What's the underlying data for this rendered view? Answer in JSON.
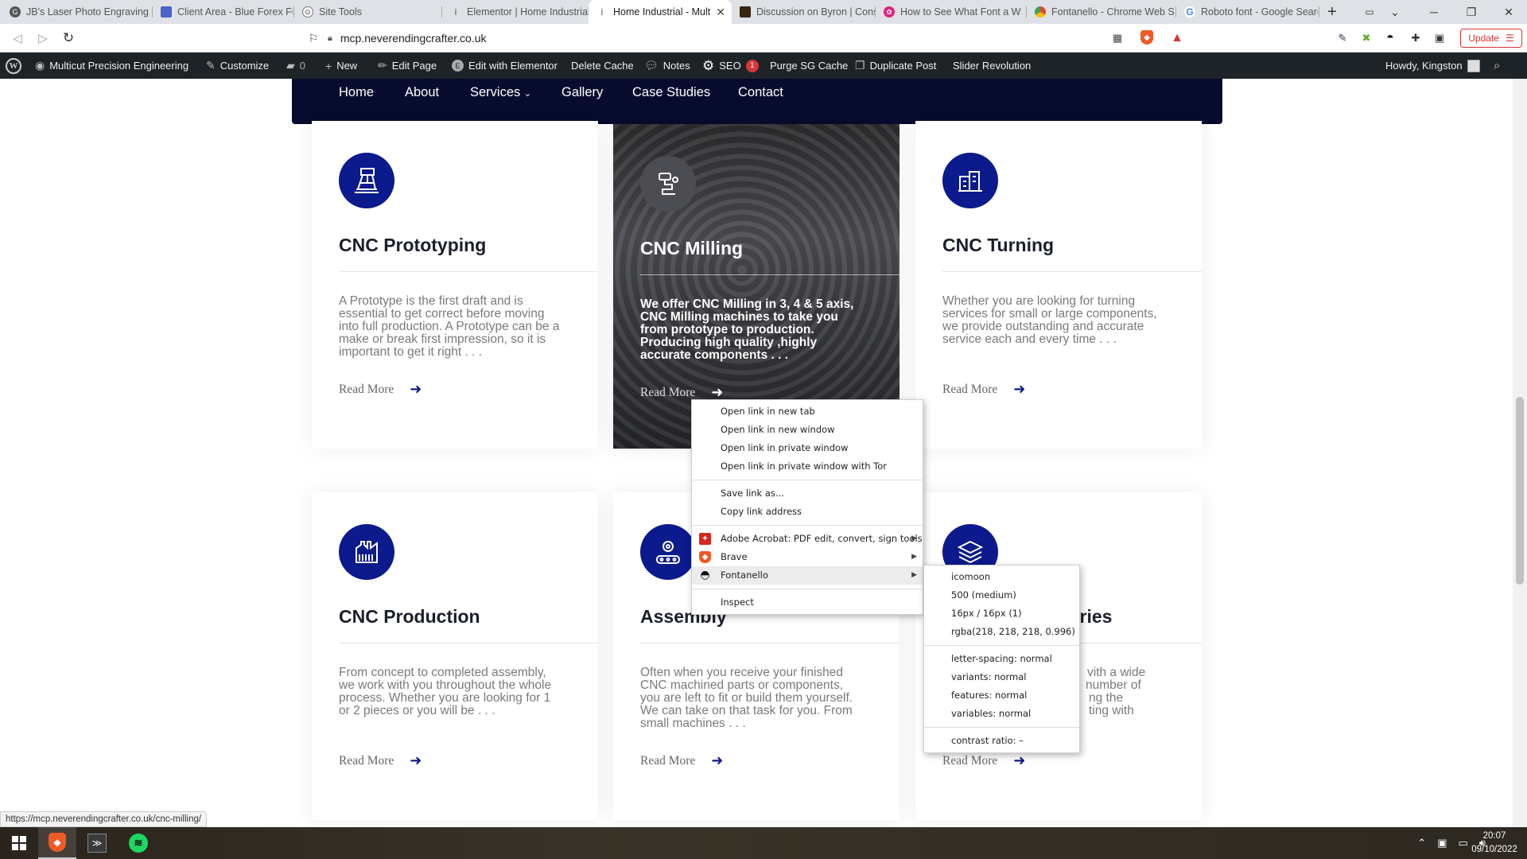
{
  "browser": {
    "tabs": [
      {
        "title": "JB's Laser Photo Engraving",
        "fav_color": "#555",
        "fav": "G"
      },
      {
        "title": "Client Area - Blue Forex Fu",
        "fav_color": "#4a64c8",
        "fav": ""
      },
      {
        "title": "Site Tools",
        "fav_color": "#4a4a4a",
        "fav": "⊙"
      },
      {
        "title": "Elementor | Home Industrial",
        "fav_color": "#777",
        "fav": "i"
      },
      {
        "title": "Home Industrial - Mult",
        "fav_color": "#777",
        "fav": "i"
      },
      {
        "title": "Discussion on Byron | Cons",
        "fav_color": "#3b2410",
        "fav": ""
      },
      {
        "title": "How to See What Font a W",
        "fav_color": "#e0227a",
        "fav": "✿"
      },
      {
        "title": "Fontanello - Chrome Web S",
        "fav_color": "#e34b2a",
        "fav": ""
      },
      {
        "title": "Roboto font - Google Searc",
        "fav_color": "#4285f4",
        "fav": "G"
      }
    ],
    "active_tab_index": 4,
    "new_tab_symbol": "+",
    "url": "mcp.neverendingcrafter.co.uk",
    "update_label": "Update"
  },
  "wpbar": {
    "site_name": "Multicut Precision Engineering",
    "customize": "Customize",
    "comments_count": "0",
    "new": "New",
    "edit_page": "Edit Page",
    "edit_elementor": "Edit with Elementor",
    "delete_cache": "Delete Cache",
    "notes": "Notes",
    "seo": "SEO",
    "seo_count": "1",
    "purge": "Purge SG Cache",
    "duplicate": "Duplicate Post",
    "slider": "Slider Revolution",
    "howdy": "Howdy, Kingston"
  },
  "site_nav": {
    "home": "Home",
    "about": "About",
    "services": "Services",
    "gallery": "Gallery",
    "case_studies": "Case Studies",
    "contact": "Contact"
  },
  "cards": [
    {
      "title": "CNC Prototyping",
      "text": "A Prototype is the first draft and is essential to get correct before moving into full production. A Prototype can be a make or break first impression, so it is important to get it right . . .",
      "read_more": "Read More"
    },
    {
      "title": "CNC Milling",
      "text": "We offer CNC Milling in 3, 4 & 5 axis, CNC Milling machines to take you from prototype to production. Producing high quality ,highly accurate components . . .",
      "read_more": "Read More"
    },
    {
      "title": "CNC Turning",
      "text": "Whether you are looking for turning services for small or large components, we provide outstanding and accurate service each and every time . . .",
      "read_more": "Read More"
    },
    {
      "title": "CNC Production",
      "text": "From concept to completed assembly, we work with you throughout the whole process. Whether you are looking for 1 or 2 pieces or you will be . . .",
      "read_more": "Read More"
    },
    {
      "title": "Assembly",
      "text": "Often when you receive your finished CNC machined parts or components, you are left to fit or build them yourself. We can take on that task for you. From small machines . . .",
      "read_more": "Read More"
    },
    {
      "title": "ustries",
      "text_lines": [
        "vith a wide",
        "number of",
        "ng the",
        "ting with"
      ],
      "read_more": "Read More"
    }
  ],
  "context_menu": {
    "open_new_tab": "Open link in new tab",
    "open_new_window": "Open link in new window",
    "open_private": "Open link in private window",
    "open_tor": "Open link in private window with Tor",
    "save_link": "Save link as...",
    "copy_link": "Copy link address",
    "acrobat": "Adobe Acrobat: PDF edit, convert, sign tools",
    "brave": "Brave",
    "fontanello": "Fontanello",
    "inspect": "Inspect"
  },
  "fontanello_menu": {
    "family": "icomoon",
    "weight": "500 (medium)",
    "size": "16px / 16px (1)",
    "color": "rgba(218, 218, 218, 0.996)",
    "letter_spacing": "letter-spacing: normal",
    "variants": "variants: normal",
    "features": "features: normal",
    "variables": "variables: normal",
    "contrast": "contrast ratio: –"
  },
  "status_url": "https://mcp.neverendingcrafter.co.uk/cnc-milling/",
  "taskbar": {
    "time": "20:07",
    "date": "09/10/2022"
  }
}
